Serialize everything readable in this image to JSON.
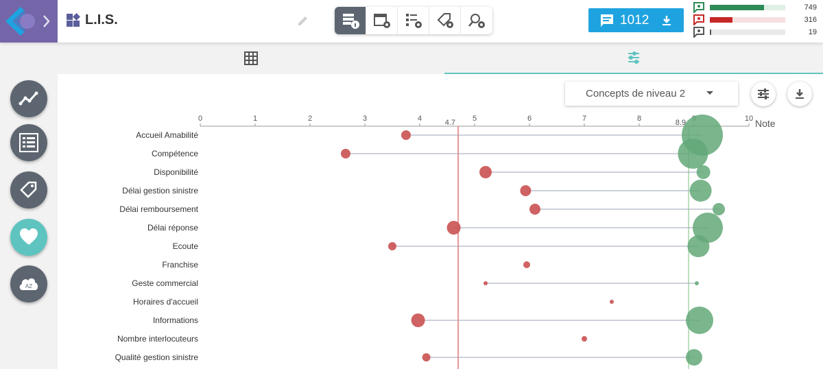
{
  "app": {
    "title": "L.I.S."
  },
  "toolbar": {
    "buttons": [
      "list-info",
      "calendar-settings",
      "checklist-settings",
      "tag-settings",
      "search-user-settings"
    ],
    "active_index": 0
  },
  "count_button": {
    "label": "1012"
  },
  "stats": [
    {
      "value": "749",
      "fraction": 0.72,
      "color": "#2e8b57",
      "track": "#dff0e5",
      "icon": "positive-comment-icon"
    },
    {
      "value": "316",
      "fraction": 0.3,
      "color": "#c62828",
      "track": "#f7e0e0",
      "icon": "negative-comment-icon"
    },
    {
      "value": "19",
      "fraction": 0.02,
      "color": "#555555",
      "track": "#eaeaea",
      "icon": "neutral-comment-icon"
    }
  ],
  "sidebar": [
    "trend-icon",
    "checklist-icon",
    "tags-icon",
    "heart-icon",
    "az-cloud-icon"
  ],
  "sidebar_cloud_text": "AZ",
  "dropdown": {
    "label": "Concepts de niveau 2"
  },
  "colors": {
    "negative": "#cc5a5a",
    "positive": "#63a878",
    "accent": "#5fc4c0",
    "dark": "#5d6670"
  },
  "chart_data": {
    "type": "scatter",
    "xlabel": "Note",
    "xlim": [
      0,
      10
    ],
    "xticks": [
      "0",
      "1",
      "2",
      "3",
      "4",
      "5",
      "6",
      "7",
      "8",
      "9",
      "10"
    ],
    "reference_lines": [
      {
        "value": 4.7,
        "label": "4.7",
        "color": "#e57373"
      },
      {
        "value": 8.9,
        "label": "8.9",
        "color": "#a5d6a7"
      }
    ],
    "categories": [
      "Accueil Amabilité",
      "Compétence",
      "Disponibilité",
      "Délai gestion sinistre",
      "Délai remboursement",
      "Délai réponse",
      "Ecoute",
      "Franchise",
      "Geste commercial",
      "Horaires d'accueil",
      "Informations",
      "Nombre interlocuteurs",
      "Qualité gestion sinistre"
    ],
    "series": [
      {
        "name": "",
        "color": "#cc5a5a",
        "values": [
          3.75,
          2.65,
          5.2,
          5.93,
          6.1,
          4.62,
          3.5,
          5.95,
          5.2,
          7.5,
          3.97,
          7.0,
          4.12
        ],
        "sizes": [
          7,
          7,
          9,
          8,
          8,
          10,
          6,
          5,
          3,
          3,
          10,
          4,
          6
        ]
      },
      {
        "name": "",
        "color": "#63a878",
        "values": [
          9.15,
          8.98,
          9.17,
          9.12,
          9.45,
          9.25,
          9.08,
          null,
          9.05,
          null,
          9.1,
          null,
          9.0
        ],
        "sizes": [
          30,
          22,
          10,
          16,
          9,
          22,
          16,
          0,
          3,
          0,
          20,
          0,
          12
        ]
      }
    ]
  }
}
